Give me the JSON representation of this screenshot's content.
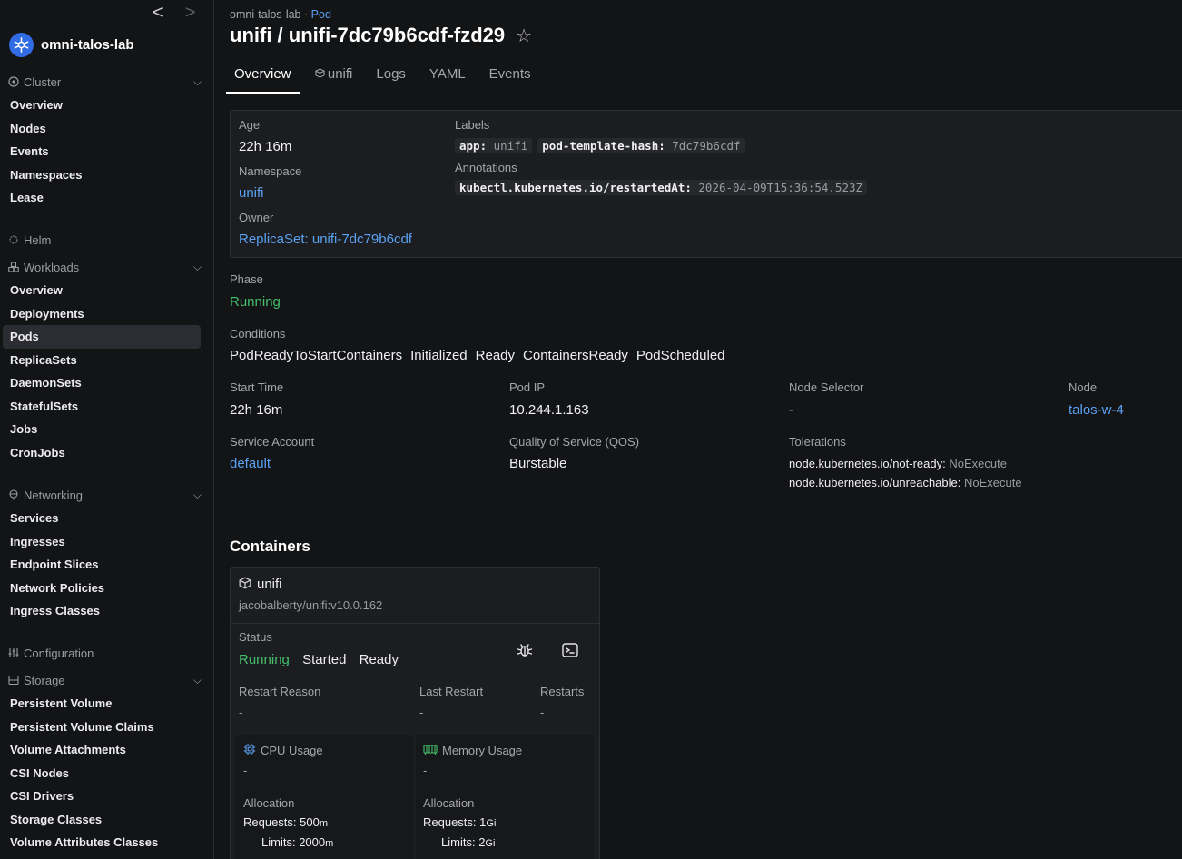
{
  "sidebar": {
    "back_arrow": "<",
    "forward_arrow": ">",
    "cluster_name": "omni-talos-lab",
    "sections": {
      "cluster": {
        "title": "Cluster",
        "items": [
          "Overview",
          "Nodes",
          "Events",
          "Namespaces",
          "Lease"
        ]
      },
      "helm": {
        "title": "Helm"
      },
      "workloads": {
        "title": "Workloads",
        "items": [
          "Overview",
          "Deployments",
          "Pods",
          "ReplicaSets",
          "DaemonSets",
          "StatefulSets",
          "Jobs",
          "CronJobs"
        ],
        "active": "Pods"
      },
      "networking": {
        "title": "Networking",
        "items": [
          "Services",
          "Ingresses",
          "Endpoint Slices",
          "Network Policies",
          "Ingress Classes"
        ]
      },
      "configuration": {
        "title": "Configuration"
      },
      "storage": {
        "title": "Storage",
        "items": [
          "Persistent Volume",
          "Persistent Volume Claims",
          "Volume Attachments",
          "CSI Nodes",
          "CSI Drivers",
          "Storage Classes",
          "Volume Attributes Classes"
        ]
      }
    }
  },
  "header": {
    "breadcrumb_cluster": "omni-talos-lab",
    "breadcrumb_sep": "·",
    "breadcrumb_kind": "Pod",
    "title": "unifi / unifi-7dc79b6cdf-fzd29",
    "tabs": [
      "Overview",
      "unifi",
      "Logs",
      "YAML",
      "Events"
    ],
    "active_tab": "Overview"
  },
  "metadata": {
    "age_label": "Age",
    "age": "22h 16m",
    "namespace_label": "Namespace",
    "namespace": "unifi",
    "owner_label": "Owner",
    "owner": "ReplicaSet: unifi-7dc79b6cdf",
    "labels_label": "Labels",
    "labels": [
      {
        "key": "app:",
        "value": "unifi"
      },
      {
        "key": "pod-template-hash:",
        "value": "7dc79b6cdf"
      }
    ],
    "annotations_label": "Annotations",
    "annotations": [
      {
        "key": "kubectl.kubernetes.io/restartedAt:",
        "value": "2026-04-09T15:36:54.523Z"
      }
    ]
  },
  "status": {
    "phase_label": "Phase",
    "phase": "Running",
    "conditions_label": "Conditions",
    "conditions": [
      "PodReadyToStartContainers",
      "Initialized",
      "Ready",
      "ContainersReady",
      "PodScheduled"
    ],
    "start_time_label": "Start Time",
    "start_time": "22h 16m",
    "pod_ip_label": "Pod IP",
    "pod_ip": "10.244.1.163",
    "node_selector_label": "Node Selector",
    "node_selector": "-",
    "node_label": "Node",
    "node": "talos-w-4",
    "service_account_label": "Service Account",
    "service_account": "default",
    "qos_label": "Quality of Service (QOS)",
    "qos": "Burstable",
    "tolerations_label": "Tolerations",
    "tolerations": [
      {
        "key": "node.kubernetes.io/not-ready:",
        "effect": "NoExecute"
      },
      {
        "key": "node.kubernetes.io/unreachable:",
        "effect": "NoExecute"
      }
    ]
  },
  "containers": {
    "heading": "Containers",
    "items": [
      {
        "name": "unifi",
        "image": "jacobalberty/unifi:v10.0.162",
        "status_label": "Status",
        "state": "Running",
        "flags": [
          "Started",
          "Ready"
        ],
        "restart_reason_label": "Restart Reason",
        "restart_reason": "-",
        "last_restart_label": "Last Restart",
        "last_restart": "-",
        "restarts_label": "Restarts",
        "restarts": "-",
        "cpu": {
          "title": "CPU Usage",
          "usage": "-",
          "allocation_label": "Allocation",
          "requests_label": "Requests:",
          "requests_value": "500",
          "requests_unit": "m",
          "limits_label": "Limits:",
          "limits_value": "2000",
          "limits_unit": "m"
        },
        "memory": {
          "title": "Memory Usage",
          "usage": "-",
          "allocation_label": "Allocation",
          "requests_label": "Requests:",
          "requests_value": "1",
          "requests_unit": "Gi",
          "limits_label": "Limits:",
          "limits_value": "2",
          "limits_unit": "Gi"
        }
      }
    ]
  },
  "colors": {
    "link": "#5aa1f2",
    "running": "#45c06a",
    "brand": "#326ce5",
    "active_nav": "#2b2d32"
  }
}
